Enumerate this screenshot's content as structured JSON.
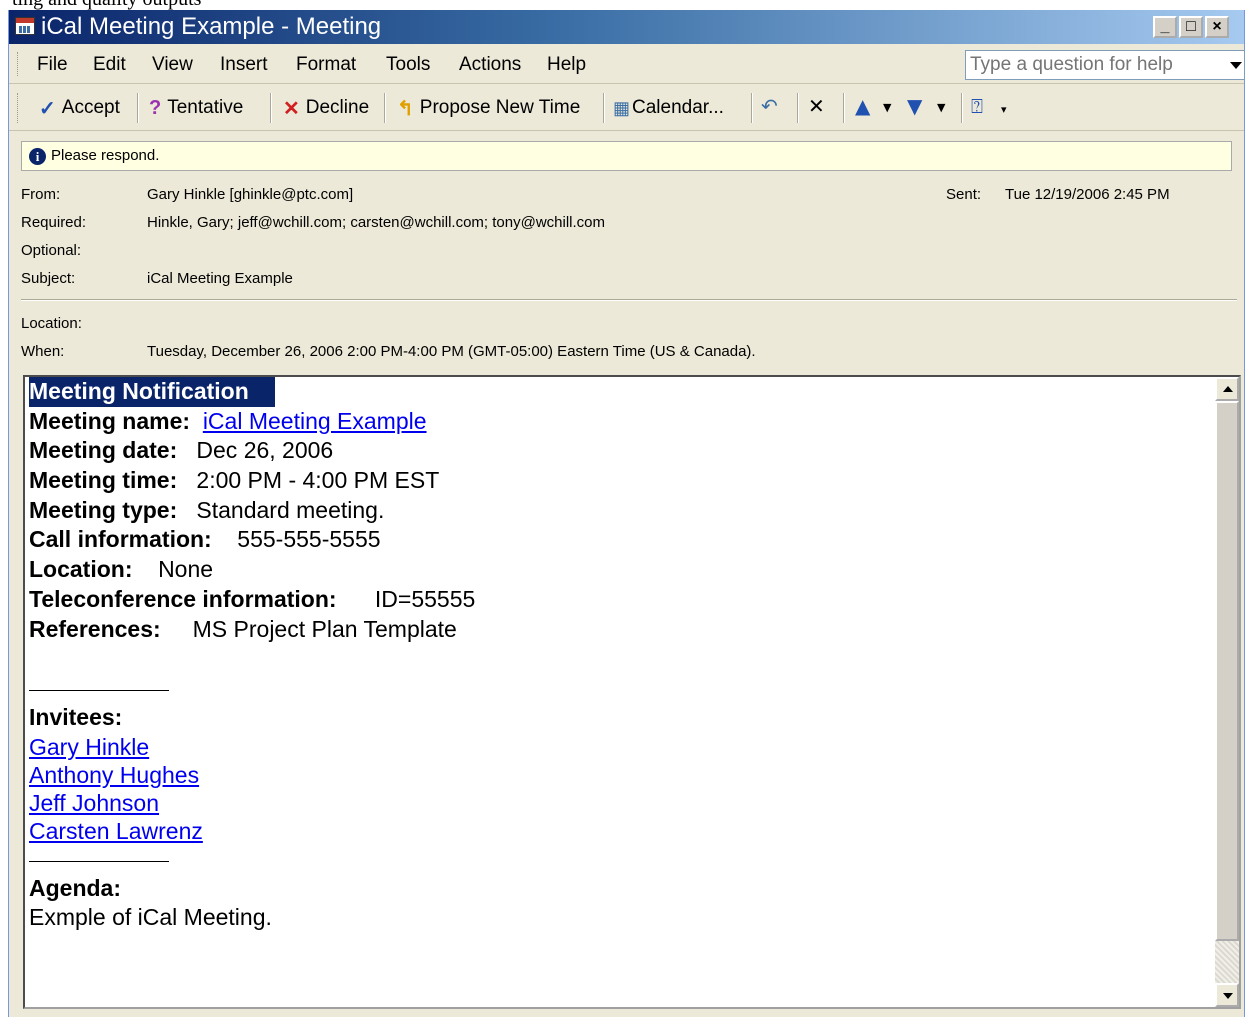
{
  "window": {
    "title": "iCal Meeting Example - Meeting",
    "min_glyph": "_",
    "max_glyph": "□",
    "close_glyph": "×"
  },
  "menu": {
    "items": [
      "File",
      "Edit",
      "View",
      "Insert",
      "Format",
      "Tools",
      "Actions",
      "Help"
    ],
    "help_placeholder": "Type a question for help"
  },
  "toolbar": {
    "accept": "Accept",
    "tentative": "Tentative",
    "decline": "Decline",
    "propose": "Propose New Time",
    "calendar": "Calendar..."
  },
  "infobar": {
    "message": "Please respond."
  },
  "header": {
    "from_label": "From:",
    "from_value": "Gary Hinkle [ghinkle@ptc.com]",
    "sent_label": "Sent:",
    "sent_value": "Tue 12/19/2006 2:45 PM",
    "required_label": "Required:",
    "required_value": "Hinkle, Gary; jeff@wchill.com; carsten@wchill.com; tony@wchill.com",
    "optional_label": "Optional:",
    "optional_value": "",
    "subject_label": "Subject:",
    "subject_value": "iCal Meeting Example",
    "location_label": "Location:",
    "location_value": "",
    "when_label": "When:",
    "when_value": "Tuesday, December 26, 2006 2:00 PM-4:00 PM (GMT-05:00) Eastern Time (US & Canada)."
  },
  "body": {
    "heading": "Meeting Notification",
    "name_label": "Meeting name:",
    "name_value": "iCal Meeting Example",
    "date_label": "Meeting date:",
    "date_value": "Dec 26, 2006",
    "time_label": "Meeting time:",
    "time_value": "2:00 PM - 4:00 PM EST",
    "type_label": "Meeting type:",
    "type_value": "Standard meeting.",
    "call_label": "Call information:",
    "call_value": "555-555-5555",
    "location_label": "Location:",
    "location_value": "None",
    "tele_label": "Teleconference information:",
    "tele_value": "ID=55555",
    "refs_label": "References:",
    "refs_value": "MS Project Plan Template",
    "invitees_label": "Invitees:",
    "invitees": [
      "Gary Hinkle",
      "Anthony Hughes",
      "Jeff Johnson",
      "Carsten Lawrenz"
    ],
    "agenda_label": "Agenda:",
    "agenda_value": "Exmple of iCal Meeting."
  }
}
